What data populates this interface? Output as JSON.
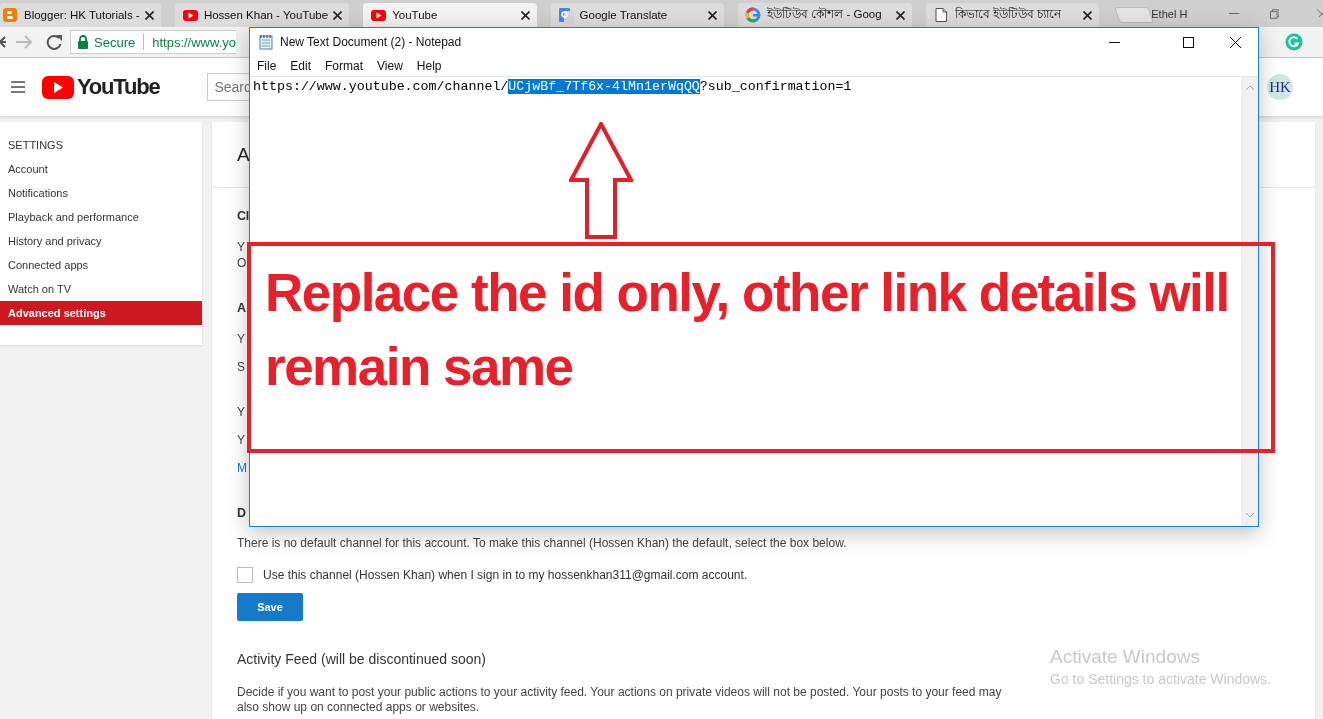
{
  "browser": {
    "tabs": [
      {
        "title": "Blogger: HK Tutorials -",
        "kind": "blogger",
        "selected": false
      },
      {
        "title": "Hossen Khan - YouTube",
        "kind": "youtube",
        "selected": false
      },
      {
        "title": "YouTube",
        "kind": "youtube",
        "selected": true
      },
      {
        "title": "Google Translate",
        "kind": "translate",
        "selected": false
      },
      {
        "title": "ইউটিউব কৌশল - Goog",
        "kind": "google",
        "selected": false
      },
      {
        "title": "কিভাবে ইউটিউব চ্যানে",
        "kind": "document",
        "selected": false
      }
    ],
    "profile": "Ethel H",
    "address": {
      "secure_label": "Secure",
      "url": "https://www.yo"
    }
  },
  "youtube": {
    "logo": "YouTube",
    "search_placeholder": "Searc",
    "avatar": "HK"
  },
  "sidebar": {
    "heading": "SETTINGS",
    "items": [
      {
        "label": "Account",
        "selected": false
      },
      {
        "label": "Notifications",
        "selected": false
      },
      {
        "label": "Playback and performance",
        "selected": false
      },
      {
        "label": "History and privacy",
        "selected": false
      },
      {
        "label": "Connected apps",
        "selected": false
      },
      {
        "label": "Watch on TV",
        "selected": false
      },
      {
        "label": "Advanced settings",
        "selected": true
      }
    ]
  },
  "content": {
    "heading": "A",
    "sections": [
      {
        "heading": "Cl",
        "paragraphs": [
          {
            "lines": [
              "Y",
              "O"
            ],
            "kind": "text"
          }
        ]
      },
      {
        "heading": "A",
        "paragraphs": [
          {
            "lines": [
              "Y"
            ],
            "kind": "text"
          },
          {
            "lines": [
              "S"
            ],
            "kind": "text"
          }
        ]
      },
      {
        "paragraphs": [
          {
            "lines": [
              "Y"
            ],
            "kind": "text"
          },
          {
            "lines": [
              "Y"
            ],
            "kind": "text"
          },
          {
            "lines": [
              "M"
            ],
            "kind": "link"
          }
        ]
      }
    ],
    "default_channel": {
      "heading": "D",
      "text": "There is no default channel for this account. To make this channel (Hossen Khan) the default, select the box below.",
      "checkbox": {
        "label": "Use this channel (Hossen Khan) when I sign in to my hossenkhan311@gmail.com account.",
        "checked": false
      },
      "save": "Save"
    },
    "activity_feed": {
      "heading": "Activity Feed (will be discontinued soon)",
      "text": "Decide if you want to post your public actions to your activity feed. Your actions on private videos will not be posted. Your posts to your feed may also show up on connected apps or websites."
    }
  },
  "notepad": {
    "title": "New Text Document (2) - Notepad",
    "menu": [
      "File",
      "Edit",
      "Format",
      "View",
      "Help"
    ],
    "text_before": "https://www.youtube.com/channel/",
    "selected_text": "UCjwBf_7Tf6x-4lMn1erWqQQ",
    "text_after": "?sub_confirmation=1"
  },
  "annotation": {
    "text": "Replace the id only, other link details will remain same"
  },
  "windows_notice": {
    "title": "Activate Windows",
    "subtitle": "Go to Settings to activate Windows."
  }
}
